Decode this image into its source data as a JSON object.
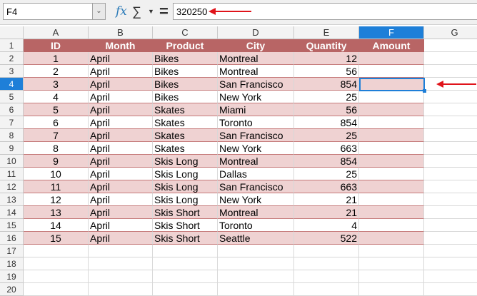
{
  "formula_bar": {
    "name_box": "F4",
    "fx_icon": "fx-icon",
    "sum_icon": "sigma-icon",
    "equals": "=",
    "value": "320250"
  },
  "columns": [
    "A",
    "B",
    "C",
    "D",
    "E",
    "F",
    "G"
  ],
  "selected_cell": {
    "column": "F",
    "row": 4
  },
  "header": [
    "ID",
    "Month",
    "Product",
    "City",
    "Quantity",
    "Amount"
  ],
  "rows": [
    [
      "1",
      "April",
      "Bikes",
      "Montreal",
      "12",
      ""
    ],
    [
      "2",
      "April",
      "Bikes",
      "Montreal",
      "56",
      ""
    ],
    [
      "3",
      "April",
      "Bikes",
      "San Francisco",
      "854",
      ""
    ],
    [
      "4",
      "April",
      "Bikes",
      "New York",
      "25",
      ""
    ],
    [
      "5",
      "April",
      "Skates",
      "Miami",
      "56",
      ""
    ],
    [
      "6",
      "April",
      "Skates",
      "Toronto",
      "854",
      ""
    ],
    [
      "7",
      "April",
      "Skates",
      "San Francisco",
      "25",
      ""
    ],
    [
      "8",
      "April",
      "Skates",
      "New York",
      "663",
      ""
    ],
    [
      "9",
      "April",
      "Skis Long",
      "Montreal",
      "854",
      ""
    ],
    [
      "10",
      "April",
      "Skis Long",
      "Dallas",
      "25",
      ""
    ],
    [
      "11",
      "April",
      "Skis Long",
      "San Francisco",
      "663",
      ""
    ],
    [
      "12",
      "April",
      "Skis Long",
      "New York",
      "21",
      ""
    ],
    [
      "13",
      "April",
      "Skis Short",
      "Montreal",
      "21",
      ""
    ],
    [
      "14",
      "April",
      "Skis Short",
      "Toronto",
      "4",
      ""
    ],
    [
      "15",
      "April",
      "Skis Short",
      "Seattle",
      "522",
      ""
    ]
  ],
  "row_numbers": [
    "1",
    "2",
    "3",
    "4",
    "5",
    "6",
    "7",
    "8",
    "9",
    "10",
    "11",
    "12",
    "13",
    "14",
    "15",
    "16",
    "17",
    "18",
    "19",
    "20"
  ],
  "colors": {
    "header": "#b86565",
    "band": "#efd2d2",
    "accent": "#1e7fd8",
    "arrow": "#e0131a"
  }
}
